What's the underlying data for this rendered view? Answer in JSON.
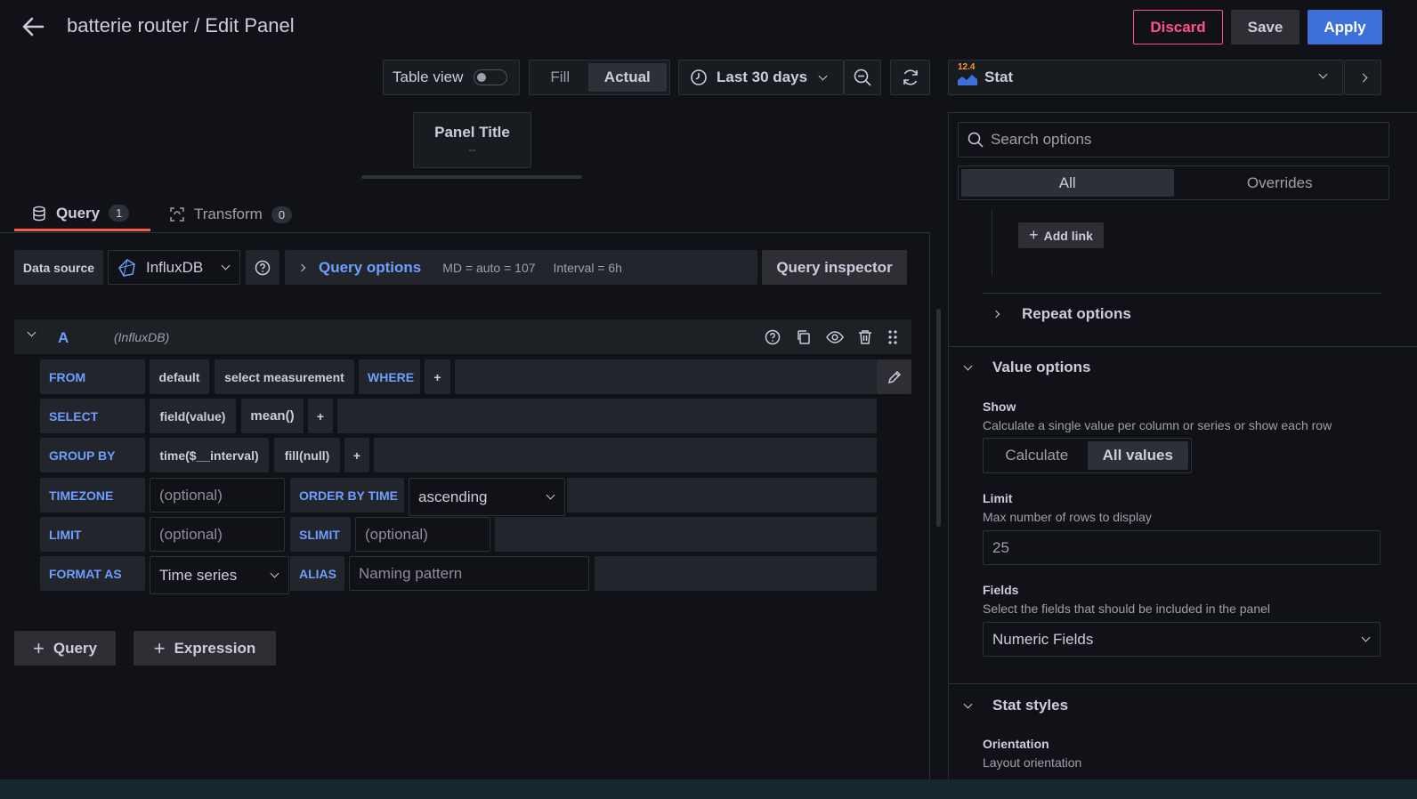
{
  "header": {
    "title": "batterie router / Edit Panel",
    "discard_label": "Discard",
    "save_label": "Save",
    "apply_label": "Apply"
  },
  "toolbar": {
    "table_view_label": "Table view",
    "fill_label": "Fill",
    "actual_label": "Actual",
    "time_range": "Last 30 days"
  },
  "viz": {
    "version_badge": "12.4",
    "type": "Stat"
  },
  "preview": {
    "panel_title": "Panel Title",
    "placeholder": "--"
  },
  "tabs": [
    {
      "label": "Query",
      "count": "1"
    },
    {
      "label": "Transform",
      "count": "0"
    }
  ],
  "datasource": {
    "label": "Data source",
    "name": "InfluxDB",
    "query_options_label": "Query options",
    "md_info": "MD = auto = 107",
    "interval_info": "Interval = 6h",
    "inspector_label": "Query inspector"
  },
  "query": {
    "ref_id": "A",
    "ds_name": "(InfluxDB)",
    "from_kw": "FROM",
    "from_policy": "default",
    "from_measurement": "select measurement",
    "where_kw": "WHERE",
    "plus": "+",
    "select_kw": "SELECT",
    "select_field": "field(value)",
    "select_fn": "mean()",
    "groupby_kw": "GROUP BY",
    "groupby_time": "time($__interval)",
    "groupby_fill": "fill(null)",
    "timezone_kw": "TIMEZONE",
    "optional_placeholder": "(optional)",
    "orderby_kw": "ORDER BY TIME",
    "order_value": "ascending",
    "limit_kw": "LIMIT",
    "slimit_kw": "SLIMIT",
    "format_kw": "FORMAT AS",
    "format_value": "Time series",
    "alias_kw": "ALIAS",
    "alias_placeholder": "Naming pattern"
  },
  "actions": {
    "add_query": "Query",
    "add_expression": "Expression"
  },
  "options": {
    "search_placeholder": "Search options",
    "tab_all": "All",
    "tab_overrides": "Overrides",
    "add_link": "Add link",
    "repeat_options": "Repeat options",
    "value_options": "Value options",
    "show_label": "Show",
    "show_desc": "Calculate a single value per column or series or show each row",
    "show_calculate": "Calculate",
    "show_all_values": "All values",
    "limit_label": "Limit",
    "limit_desc": "Max number of rows to display",
    "limit_value": "25",
    "fields_label": "Fields",
    "fields_desc": "Select the fields that should be included in the panel",
    "fields_value": "Numeric Fields",
    "stat_styles": "Stat styles",
    "orientation_label": "Orientation",
    "orientation_desc": "Layout orientation"
  },
  "colors": {
    "background": "#111217",
    "accent": "#3d71d9",
    "discard": "#ff5286",
    "keyword": "#6e9fff",
    "tab_underline": "#f55f3e"
  }
}
